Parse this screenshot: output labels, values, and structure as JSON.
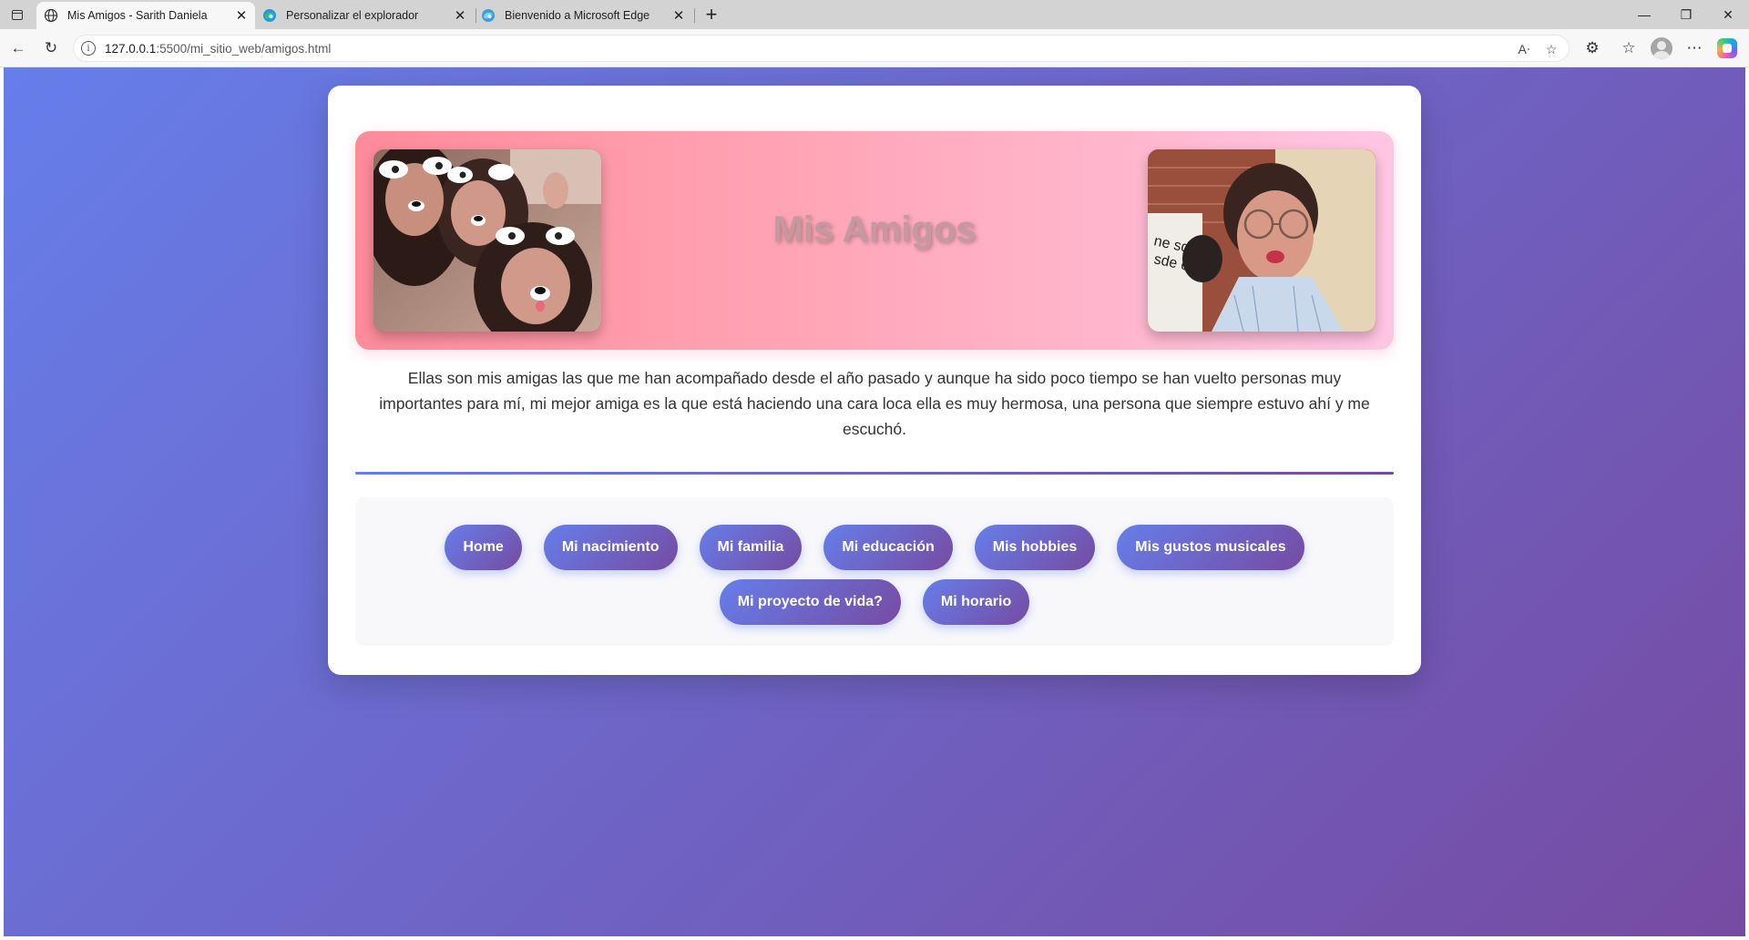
{
  "browser": {
    "tabs": [
      {
        "title": "Mis Amigos - Sarith Daniela",
        "icon": "globe-icon",
        "active": true
      },
      {
        "title": "Personalizar el explorador",
        "icon": "edge-icon",
        "active": false
      },
      {
        "title": "Bienvenido a Microsoft Edge",
        "icon": "edge-icon",
        "active": false
      }
    ],
    "new_tab_label": "+",
    "url_host": "127.0.0.1",
    "url_rest": ":5500/mi_sitio_web/amigos.html"
  },
  "page": {
    "title": "Mis Amigos",
    "description": "Ellas son mis amigas las que me han acompañado desde el año pasado y aunque ha sido poco tiempo se han vuelto personas muy importantes para mí, mi mejor amiga es la que está haciendo una cara loca ella es muy hermosa, una persona que siempre estuvo ahí y me escuchó.",
    "photos": [
      {
        "name": "friends-group-photo"
      },
      {
        "name": "best-friend-photo"
      }
    ],
    "nav": [
      {
        "label": "Home"
      },
      {
        "label": "Mi nacimiento"
      },
      {
        "label": "Mi familia"
      },
      {
        "label": "Mi educación"
      },
      {
        "label": "Mis hobbies"
      },
      {
        "label": "Mis gustos musicales"
      },
      {
        "label": "Mi proyecto de vida?"
      },
      {
        "label": "Mi horario"
      }
    ]
  },
  "colors": {
    "gradient_start": "#667eea",
    "gradient_end": "#764ba2",
    "banner_pink": "#ffa6b7",
    "title_color": "#c59a9e"
  }
}
